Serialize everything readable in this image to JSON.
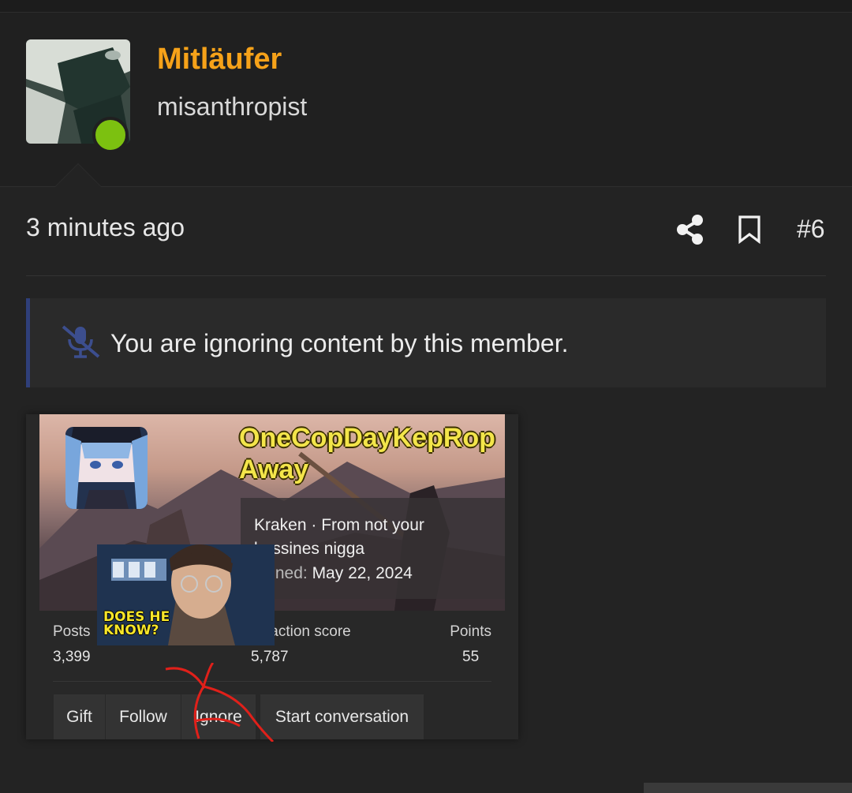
{
  "post": {
    "username": "Mitläufer",
    "user_title": "misanthropist",
    "timestamp": "3 minutes ago",
    "post_number": "#6",
    "ignore_notice": "You are ignoring content by this member."
  },
  "tooltip": {
    "name": "OneCopDayKepRop Away",
    "info_line": "Kraken · From not your bussines nigga",
    "joined_label": "Joined:",
    "joined_date": "May 22, 2024",
    "stats": [
      {
        "label": "Posts",
        "value": "3,399"
      },
      {
        "label": "Reaction score",
        "value": "5,787"
      },
      {
        "label": "Points",
        "value": "55"
      }
    ],
    "actions": [
      {
        "label": "Gift"
      },
      {
        "label": "Follow"
      },
      {
        "label": "Ignore"
      },
      {
        "label": "Start conversation"
      }
    ]
  },
  "meme": {
    "caption_line1": "DOES HE",
    "caption_line2": "KNOW?"
  },
  "colors": {
    "username": "#f6a219",
    "online": "#7cc110",
    "tooltip_name": "#f3e54a",
    "notice_accent": "#2f3f7a",
    "annotation": "#e0201a"
  }
}
